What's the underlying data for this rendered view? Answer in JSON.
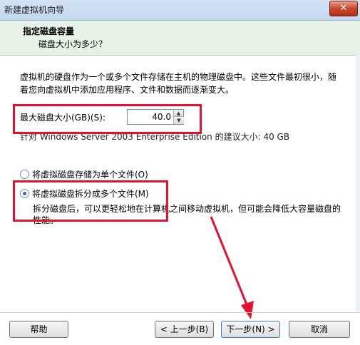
{
  "window": {
    "title": "新建虚拟机向导",
    "close_label": "✕"
  },
  "header": {
    "title": "指定磁盘容量",
    "subtitle": "磁盘大小为多少？"
  },
  "body": {
    "description": "虚拟机的硬盘作为一个或多个文件存储在主机的物理磁盘中。这些文件最初很小，随着您向虚拟机中添加应用程序、文件和数据而逐渐变大。",
    "max_size_label": "最大磁盘大小(GB)(S):",
    "max_size_value": "40.0",
    "recommendation": "针对 Windows Server 2003 Enterprise Edition 的建议大小: 40 GB",
    "option_single": "将虚拟磁盘存储为单个文件(O)",
    "option_split": "将虚拟磁盘拆分成多个文件(M)",
    "split_description": "拆分磁盘后，可以更轻松地在计算机之间移动虚拟机，但可能会降低大容量磁盘的性能。",
    "selected_option": "split"
  },
  "footer": {
    "help": "帮助",
    "back": "< 上一步(B)",
    "next": "下一步(N) >",
    "cancel": "取消"
  },
  "annotation_color": "#e8112d"
}
